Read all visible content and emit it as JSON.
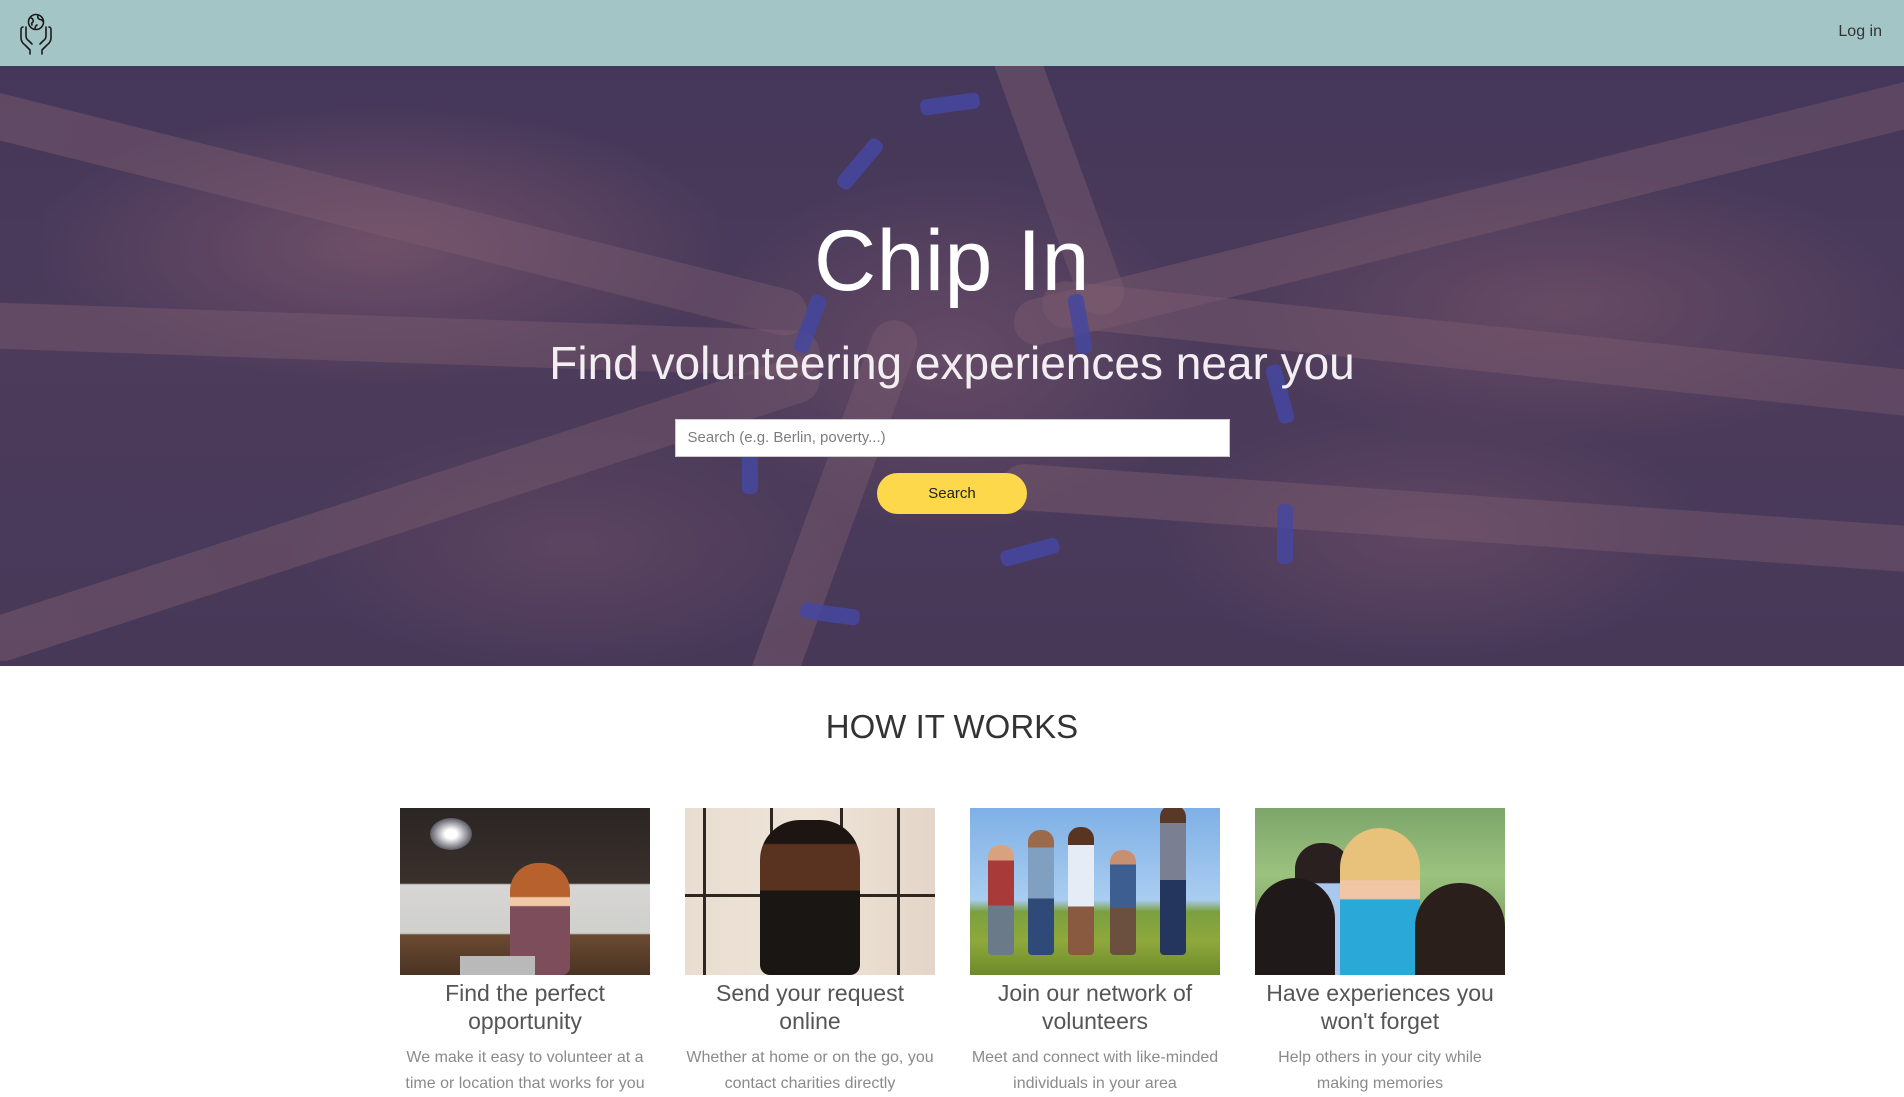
{
  "navbar": {
    "logo_icon": "hands-holding-globe-icon",
    "login_label": "Log in",
    "background_color": "#a3c5c6"
  },
  "hero": {
    "title": "Chip In",
    "subtitle": "Find volunteering experiences near you",
    "search": {
      "placeholder": "Search (e.g. Berlin, poverty...)",
      "value": ""
    },
    "search_button_label": "Search",
    "button_color": "#fcd84a",
    "background_image": "stacked-hands-with-wristbands-photo"
  },
  "how_it_works": {
    "title": "HOW IT WORKS",
    "cards": [
      {
        "image": "woman-with-laptop-in-cafe-photo",
        "title": "Find the perfect opportunity",
        "text": "We make it easy to volunteer at a time or location that works for you"
      },
      {
        "image": "man-smiling-with-phone-photo",
        "title": "Send your request online",
        "text": "Whether at home or on the go, you contact charities directly"
      },
      {
        "image": "group-running-in-field-photo",
        "title": "Join our network of volunteers",
        "text": "Meet and connect with like-minded individuals in your area"
      },
      {
        "image": "volunteer-with-children-photo",
        "title": "Have experiences you won't forget",
        "text": "Help others in your city while making memories"
      }
    ]
  }
}
